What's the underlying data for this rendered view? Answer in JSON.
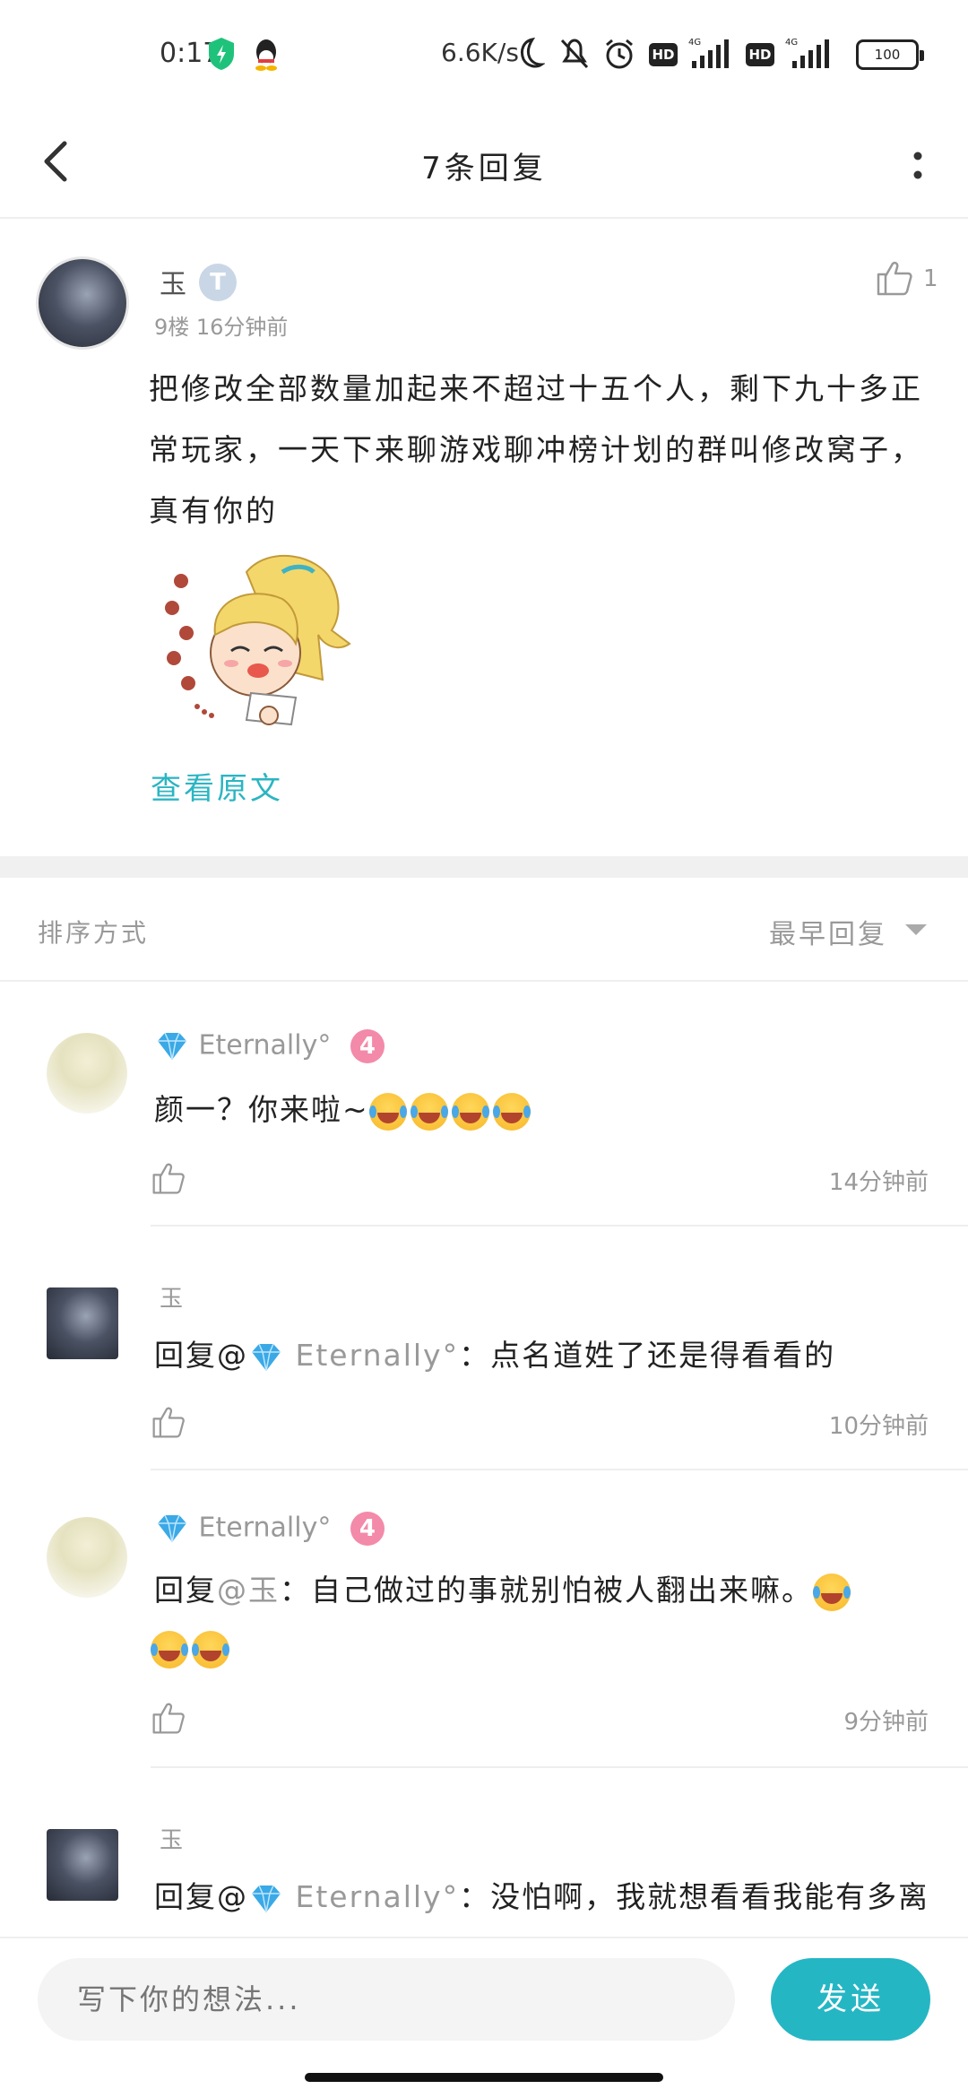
{
  "status": {
    "time": "0:17",
    "net_speed": "6.6K/s",
    "hd1": "HD",
    "hd2": "HD",
    "battery": "100"
  },
  "nav": {
    "title": "7条回复"
  },
  "main_post": {
    "author": "玉",
    "level_badge": "T",
    "meta": "9楼  16分钟前",
    "like_count": "1",
    "content": "把修改全部数量加起来不超过十五个人，剩下九十多正常玩家，一天下来聊游戏聊冲榜计划的群叫修改窝子，真有你的",
    "view_original": "查看原文"
  },
  "sort": {
    "label": "排序方式",
    "value": "最早回复"
  },
  "replies": [
    {
      "author": "Eternally°",
      "level": "4",
      "text": "颜一？你来啦~",
      "time": "14分钟前"
    },
    {
      "author": "玉",
      "prefix": "回复@",
      "mention": "Eternally°",
      "text": "：点名道姓了还是得看看的",
      "time": "10分钟前"
    },
    {
      "author": "Eternally°",
      "level": "4",
      "prefix": "回复",
      "mention": "@玉",
      "text": "：自己做过的事就别怕被人翻出来嘛。",
      "time": "9分钟前"
    },
    {
      "author": "玉",
      "prefix": "回复@",
      "mention": "Eternally°",
      "text": "：没怕啊，我就想看看我能有多离"
    }
  ],
  "composer": {
    "placeholder": "写下你的想法...",
    "send_label": "发送"
  },
  "colors": {
    "accent": "#25b6c4",
    "link": "#2bb5c2",
    "level4": "#f38aa9"
  },
  "icons": [
    "back-arrow-icon",
    "more-vertical-icon",
    "thumbs-up-icon",
    "diamond-icon",
    "laughing-emoji-icon"
  ]
}
